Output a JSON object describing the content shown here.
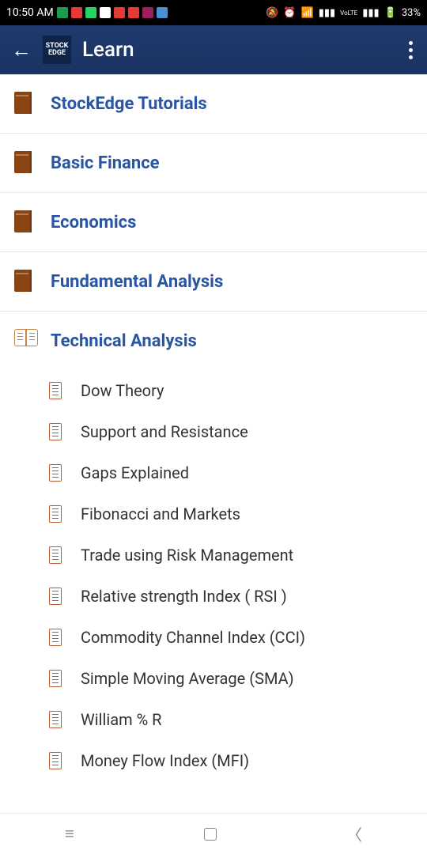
{
  "status": {
    "time": "10:50 AM",
    "battery": "33%"
  },
  "header": {
    "logo_top": "STOCK",
    "logo_bottom": "EDGE",
    "title": "Learn"
  },
  "categories": [
    {
      "label": "StockEdge Tutorials"
    },
    {
      "label": "Basic Finance"
    },
    {
      "label": "Economics"
    },
    {
      "label": "Fundamental Analysis"
    }
  ],
  "expanded": {
    "label": "Technical Analysis",
    "items": [
      {
        "label": "Dow Theory"
      },
      {
        "label": "Support and Resistance"
      },
      {
        "label": "Gaps Explained"
      },
      {
        "label": "Fibonacci and Markets"
      },
      {
        "label": "Trade using Risk Management"
      },
      {
        "label": "Relative strength Index ( RSI )"
      },
      {
        "label": "Commodity Channel Index (CCI)"
      },
      {
        "label": "Simple Moving Average (SMA)"
      },
      {
        "label": "William % R"
      },
      {
        "label": "Money Flow Index (MFI)"
      }
    ]
  }
}
